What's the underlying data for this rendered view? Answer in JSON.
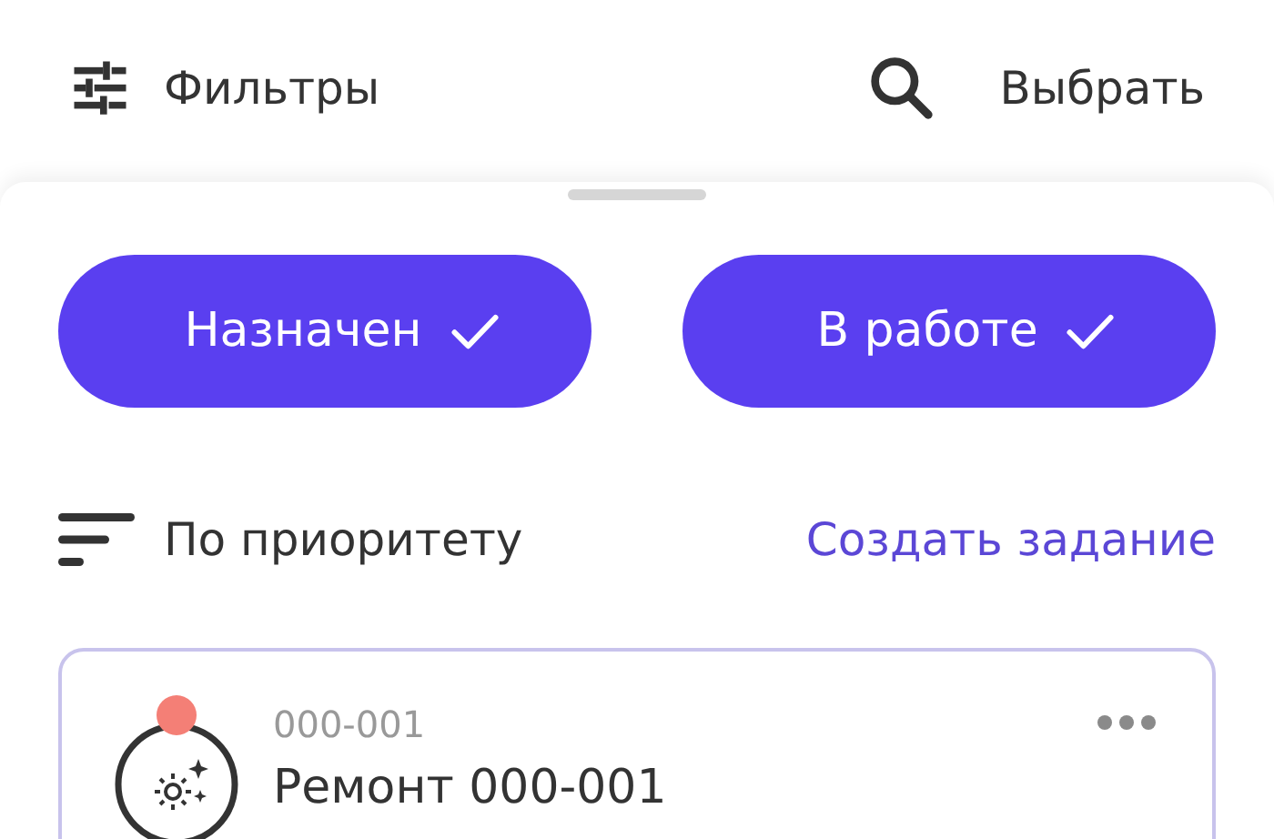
{
  "header": {
    "filters_label": "Фильтры",
    "select_label": "Выбрать"
  },
  "status_chips": [
    {
      "label": "Назначен",
      "selected": true
    },
    {
      "label": "В работе",
      "selected": true
    }
  ],
  "sort": {
    "label": "По приоритету"
  },
  "create_link": "Создать задание",
  "tasks": [
    {
      "code": "000-001",
      "title": "Ремонт 000-001",
      "color": "#f47f76"
    }
  ]
}
